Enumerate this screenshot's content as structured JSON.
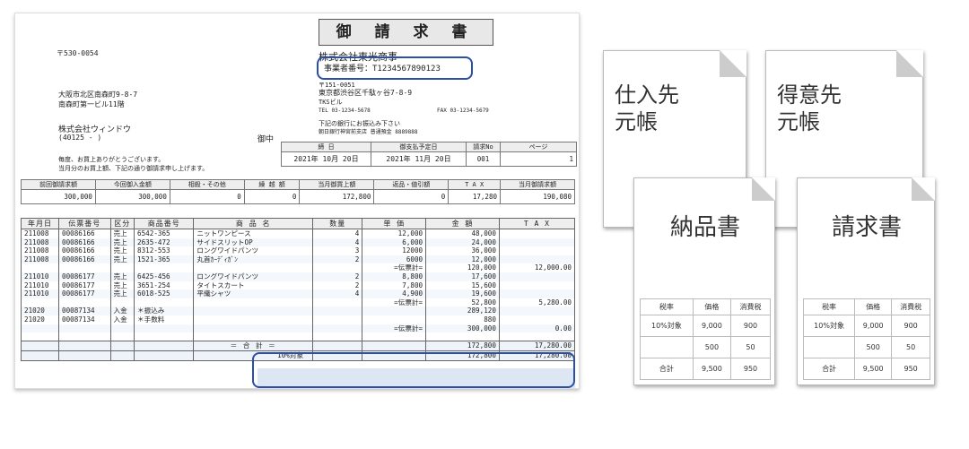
{
  "invoice": {
    "title": "御 請 求 書",
    "to_postal": "〒530-0054",
    "to_address1": "大阪市北区南森町9-8-7",
    "to_address2": "南森町第一ビル11階",
    "to_company": "株式会社ウィンドウ",
    "to_code": "(40125  -   )",
    "honorific": "御中",
    "greeting1": "毎度、お買上ありがとうございます。",
    "greeting2": "当月分のお買上額、下記の通り御請求申し上げます。",
    "from_company": "株式会社東光商事",
    "from_reg": "事業者番号：T1234567890123",
    "from_postal": "〒151-0051",
    "from_address": "東京都渋谷区千駄ヶ谷7-8-9",
    "from_building": "TKSビル",
    "from_tel": "TEL 03-1234-5678",
    "from_fax": "FAX 03-1234-5679",
    "bank_note": "下記の銀行にお振込み下さい",
    "bank_info": "朝日銀行神宮前支店  普通預金 8889888",
    "date_header": {
      "close": "締 日",
      "due": "御支払予定日",
      "no": "請求No",
      "page": "ページ"
    },
    "date_values": {
      "close": "2021年 10月  20日",
      "due": "2021年 11月  20日",
      "no": "001",
      "page": "1"
    },
    "summary_headers": [
      "前回御請求額",
      "今回御入金額",
      "相殺・その他",
      "繰 越 額",
      "当月御買上額",
      "返品・値引額",
      "T A X",
      "当月御請求額"
    ],
    "summary_values": [
      "300,000",
      "300,000",
      "0",
      "0",
      "172,800",
      "0",
      "17,280",
      "190,080"
    ],
    "item_headers": [
      "年月日",
      "伝票番号",
      "区分",
      "商品番号",
      "商 品 名",
      "数量",
      "単 価",
      "金 額",
      "T A X"
    ],
    "items": [
      [
        "211008",
        "00086166",
        "売上",
        "6542-365",
        "ニットワンピース",
        "4",
        "12,000",
        "48,000",
        ""
      ],
      [
        "211008",
        "00086166",
        "売上",
        "2635-472",
        "サイドスリットOP",
        "4",
        "6,000",
        "24,000",
        ""
      ],
      [
        "211008",
        "00086166",
        "売上",
        "8312-553",
        "ロングワイドパンツ",
        "3",
        "12000",
        "36,000",
        ""
      ],
      [
        "211008",
        "00086166",
        "売上",
        "1521-365",
        "丸首ｶｰﾃﾞｨｶﾞﾝ",
        "2",
        "6000",
        "12,000",
        ""
      ],
      [
        "",
        "",
        "",
        "",
        "",
        "",
        "=伝票計=",
        "120,000",
        "12,000.00"
      ],
      [
        "211010",
        "00086177",
        "売上",
        "6425-456",
        "ロングワイドパンツ",
        "2",
        "8,800",
        "17,600",
        ""
      ],
      [
        "211010",
        "00086177",
        "売上",
        "3651-254",
        "タイトスカート",
        "2",
        "7,800",
        "15,600",
        ""
      ],
      [
        "211010",
        "00086177",
        "売上",
        "6018-525",
        "平織シャツ",
        "4",
        "4,900",
        "19,600",
        ""
      ],
      [
        "",
        "",
        "",
        "",
        "",
        "",
        "=伝票計=",
        "52,800",
        "5,280.00"
      ],
      [
        "21020",
        "00087134",
        "入金",
        "＊振込み",
        "",
        "",
        "",
        "289,120",
        ""
      ],
      [
        "21020",
        "00087134",
        "入金",
        "＊手数料",
        "",
        "",
        "",
        "880",
        ""
      ],
      [
        "",
        "",
        "",
        "",
        "",
        "",
        "=伝票計=",
        "300,000",
        "0.00"
      ],
      [
        "",
        "",
        "",
        "",
        "",
        "",
        "",
        "",
        ""
      ]
    ],
    "total_label": "＝ 合  計 ＝",
    "total_sub": "10%対象",
    "total_amount1": "172,800",
    "total_tax1": "17,280.00",
    "total_amount2": "172,800",
    "total_tax2": "17,280.00"
  },
  "documents": {
    "ledger1": "仕入先\n元帳",
    "ledger2": "得意先\n元帳",
    "delivery": "納品書",
    "invoice": "請求書",
    "tax_headers": [
      "税率",
      "価格",
      "消費税"
    ],
    "tax_rows": [
      [
        "10%対象",
        "9,000",
        "900"
      ],
      [
        "",
        "500",
        "50"
      ],
      [
        "合計",
        "9,500",
        "950"
      ]
    ]
  },
  "colors": {
    "highlight": "#2a4fa8",
    "total_bg": "#dde7f3"
  }
}
